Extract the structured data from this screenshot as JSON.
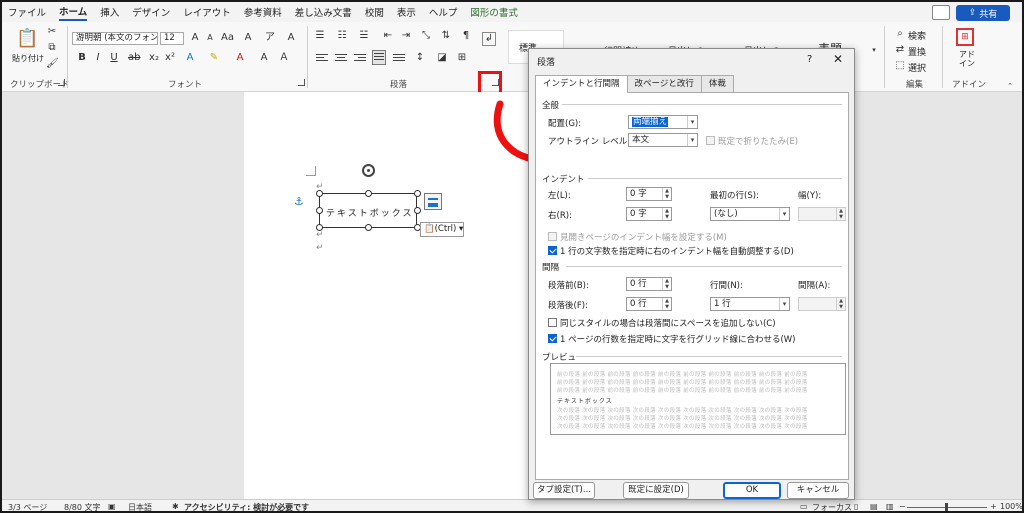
{
  "menu_tabs": [
    "ファイル",
    "ホーム",
    "挿入",
    "デザイン",
    "レイアウト",
    "参考資料",
    "差し込み文書",
    "校閲",
    "表示",
    "ヘルプ",
    "図形の書式"
  ],
  "share_label": "共有",
  "ribbon": {
    "clipboard_label": "クリップボード",
    "paste_label": "貼り付け",
    "font_label": "フォント",
    "font_name": "游明朝 (本文のフォント",
    "font_size": "12",
    "paragraph_label": "段落",
    "styles": [
      "標準",
      "行間詰め",
      "見出し 1",
      "見出し 2",
      "表題"
    ],
    "edit_label": "編集",
    "search_label": "検索",
    "replace_label": "置換",
    "select_label": "選択",
    "addin_label": "アドイン",
    "addin_short": "アド イン"
  },
  "document": {
    "textbox_text": "テキストボックス",
    "ctrl_tag": "(Ctrl)",
    "return_mark": "↵"
  },
  "status": {
    "page": "3/3 ページ",
    "words": "8/80 文字",
    "lang": "日本語",
    "accessibility": "アクセシビリティ: 検討が必要です",
    "focus": "フォーカス",
    "zoom": "100%"
  },
  "dialog": {
    "title": "段落",
    "help": "?",
    "close": "✕",
    "tabs": [
      "インデントと行間隔",
      "改ページと改行",
      "体裁"
    ],
    "general": {
      "section": "全般",
      "alignment_label": "配置(G):",
      "alignment_value": "両端揃え",
      "outline_label": "アウトライン レベル(O):",
      "outline_value": "本文",
      "collapsed_label": "既定で折りたたみ(E)"
    },
    "indent": {
      "section": "インデント",
      "left_label": "左(L):",
      "left_value": "0 字",
      "right_label": "右(R):",
      "right_value": "0 字",
      "first_line_label": "最初の行(S):",
      "first_line_value": "(なし)",
      "width_label": "幅(Y):",
      "mirror_label": "見開きページのインデント幅を設定する(M)",
      "auto_adjust_label": "1 行の文字数を指定時に右のインデント幅を自動調整する(D)"
    },
    "spacing": {
      "section": "間隔",
      "before_label": "段落前(B):",
      "before_value": "0 行",
      "after_label": "段落後(F):",
      "after_value": "0 行",
      "line_label": "行間(N):",
      "line_value": "1 行",
      "at_label": "間隔(A):",
      "no_space_label": "同じスタイルの場合は段落間にスペースを追加しない(C)",
      "grid_label": "1 ページの行数を指定時に文字を行グリッド線に合わせる(W)"
    },
    "preview": {
      "section": "プレビュー",
      "sample_gray": "前の段落 前の段落 前の段落 前の段落 前の段落 前の段落 前の段落 前の段落 前の段落 前の段落",
      "sample_text": "テキストボックス",
      "sample_after": "次の段落 次の段落 次の段落 次の段落 次の段落 次の段落 次の段落 次の段落 次の段落 次の段落"
    },
    "buttons": {
      "tabs": "タブ設定(T)...",
      "default": "既定に設定(D)",
      "ok": "OK",
      "cancel": "キャンセル"
    }
  }
}
